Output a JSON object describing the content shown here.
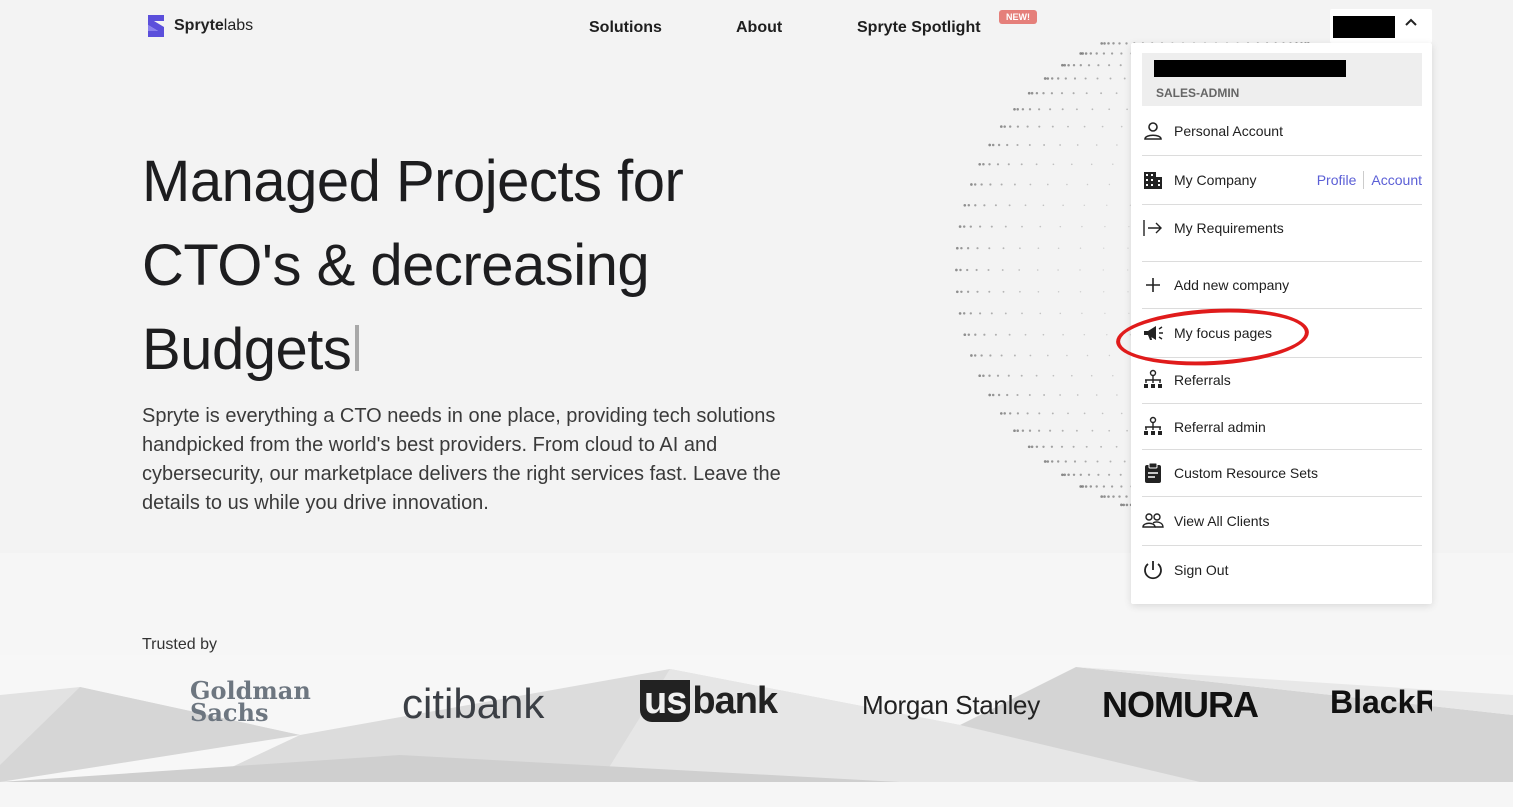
{
  "brand": {
    "name_bold": "Spryte",
    "name_light": "labs",
    "accent": "#5b4fdb"
  },
  "nav": {
    "solutions": "Solutions",
    "about": "About",
    "spotlight": "Spryte Spotlight",
    "badge": "NEW!"
  },
  "hero": {
    "headline_line1": "Managed Projects for",
    "headline_line2": "CTO's & decreasing",
    "headline_line3": "Budgets",
    "lede": "Spryte is everything a CTO needs in one place, providing tech solutions handpicked from the world's best providers. From cloud to AI and cybersecurity, our marketplace delivers the right services fast. Leave the details to us while you drive innovation."
  },
  "trusted": {
    "label": "Trusted by",
    "logos": {
      "goldman_line1": "Goldman",
      "goldman_line2": "Sachs",
      "citibank": "citibank",
      "usbank_us": "us",
      "usbank_bank": "bank",
      "morgan_stanley": "Morgan Stanley",
      "nomura": "NOMURA",
      "blackrock": "BlackR"
    }
  },
  "menu": {
    "role": "SALES-ADMIN",
    "items": [
      {
        "label": "Personal Account",
        "icon": "user-icon"
      },
      {
        "label": "My Company",
        "icon": "building-icon",
        "links": [
          "Profile",
          "Account"
        ]
      },
      {
        "label": "My Requirements",
        "icon": "arrow-right-icon"
      },
      {
        "label": "Add new company",
        "icon": "plus-icon"
      },
      {
        "label": "My focus pages",
        "icon": "megaphone-icon"
      },
      {
        "label": "Referrals",
        "icon": "hierarchy-icon"
      },
      {
        "label": "Referral admin",
        "icon": "hierarchy-icon"
      },
      {
        "label": "Custom Resource Sets",
        "icon": "clipboard-icon"
      },
      {
        "label": "View All Clients",
        "icon": "users-icon"
      },
      {
        "label": "Sign Out",
        "icon": "power-icon"
      }
    ],
    "link_color": "#5b5fd6",
    "highlight_color": "#e01b1b"
  }
}
